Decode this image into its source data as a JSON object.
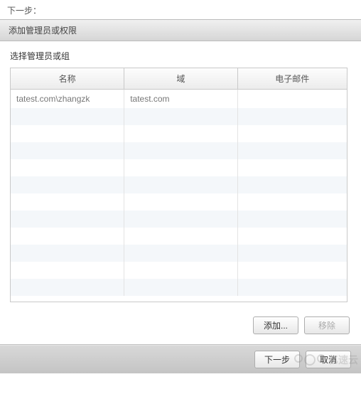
{
  "top_label": "下一步：",
  "header_title": "添加管理员或权限",
  "section_label": "选择管理员或组",
  "table": {
    "headers": {
      "name": "名称",
      "domain": "域",
      "email": "电子邮件"
    },
    "rows": [
      {
        "name": "tatest.com\\zhangzk",
        "domain": "tatest.com",
        "email": ""
      },
      {
        "name": "",
        "domain": "",
        "email": ""
      },
      {
        "name": "",
        "domain": "",
        "email": ""
      },
      {
        "name": "",
        "domain": "",
        "email": ""
      },
      {
        "name": "",
        "domain": "",
        "email": ""
      },
      {
        "name": "",
        "domain": "",
        "email": ""
      },
      {
        "name": "",
        "domain": "",
        "email": ""
      },
      {
        "name": "",
        "domain": "",
        "email": ""
      },
      {
        "name": "",
        "domain": "",
        "email": ""
      },
      {
        "name": "",
        "domain": "",
        "email": ""
      },
      {
        "name": "",
        "domain": "",
        "email": ""
      },
      {
        "name": "",
        "domain": "",
        "email": ""
      }
    ]
  },
  "buttons": {
    "add": "添加...",
    "remove": "移除",
    "next": "下一步",
    "cancel": "取消"
  },
  "watermark": "亿速云"
}
